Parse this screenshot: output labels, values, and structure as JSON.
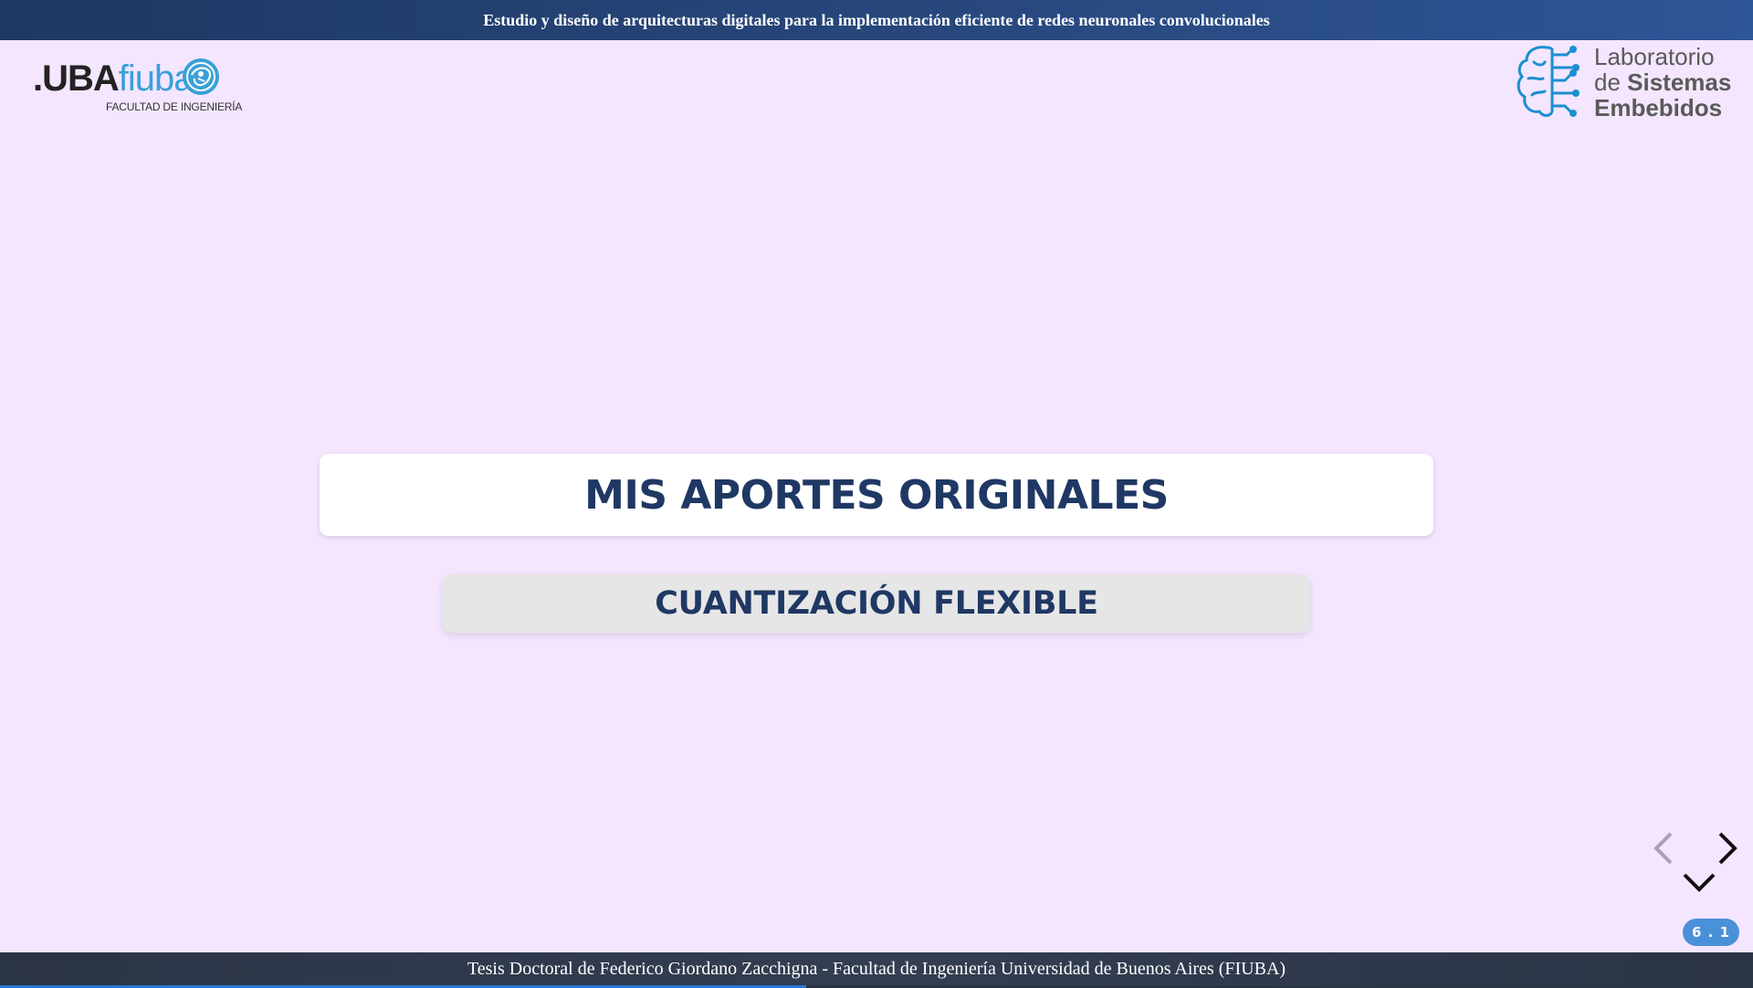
{
  "header": {
    "title": "Estudio y diseño de arquitecturas digitales para la implementación eficiente de redes neuronales convolucionales"
  },
  "logos": {
    "uba": {
      "uba": ".UBA",
      "fiuba": "fiuba",
      "subtitle": "FACULTAD DE INGENIERÍA"
    },
    "lab": {
      "line1": "Laboratorio",
      "line2_light": "de ",
      "line2_bold": "Sistemas",
      "line3": "Embebidos"
    }
  },
  "slide": {
    "title": "MIS APORTES ORIGINALES",
    "subtitle": "CUANTIZACIÓN FLEXIBLE"
  },
  "navigation": {
    "slide_number": "6 . 1",
    "left_icon": "chevron-left-icon",
    "right_icon": "chevron-right-icon",
    "down_icon": "chevron-down-icon",
    "progress": 0.46
  },
  "footer": {
    "text": "Tesis Doctoral de Federico Giordano Zacchigna - Facultad de Ingeniería Universidad de Buenos Aires (FIUBA)"
  },
  "colors": {
    "background": "#f4e6fe",
    "header": "#1f3864",
    "title_text": "#1f3864",
    "accent": "#3aa0d8",
    "slide_number_badge": "#4a90d9",
    "progress": "#2a76dd",
    "footer": "#2b3445"
  }
}
